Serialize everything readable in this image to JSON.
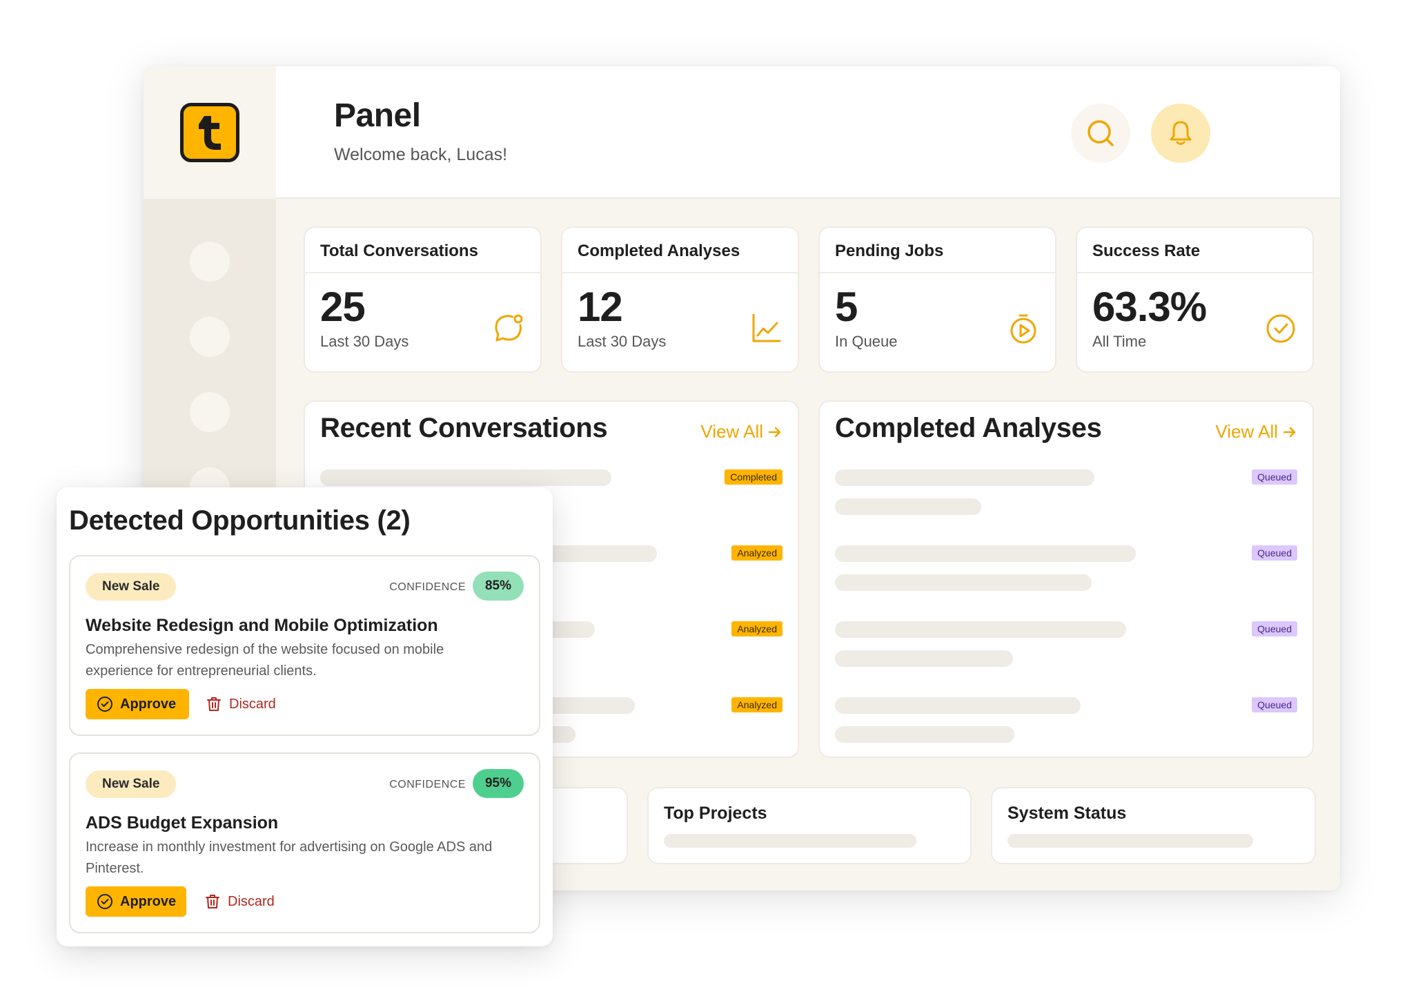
{
  "header": {
    "title": "Panel",
    "subtitle": "Welcome back, Lucas!"
  },
  "colors": {
    "accent": "#ffb400",
    "purple_badge": "#dcc7ff",
    "confidence_85": "#93e0b8",
    "confidence_95": "#4fcf8f",
    "discard_red": "#b3261e"
  },
  "stats": [
    {
      "title": "Total Conversations",
      "value": "25",
      "sub": "Last 30 Days",
      "icon": "chat-icon"
    },
    {
      "title": "Completed Analyses",
      "value": "12",
      "sub": "Last 30 Days",
      "icon": "chart-line-icon"
    },
    {
      "title": "Pending Jobs",
      "value": "5",
      "sub": "In Queue",
      "icon": "timer-play-icon"
    },
    {
      "title": "Success Rate",
      "value": "63.3%",
      "sub": "All Time",
      "icon": "check-circle-icon"
    }
  ],
  "recent_conversations": {
    "title": "Recent Conversations",
    "view_all": "View All",
    "badges": [
      "Completed",
      "Analyzed",
      "Analyzed",
      "Analyzed"
    ]
  },
  "completed_analyses": {
    "title": "Completed Analyses",
    "view_all": "View All",
    "badges": [
      "Queued",
      "Queued",
      "Queued",
      "Queued"
    ]
  },
  "bottom_cards": {
    "top_projects": "Top Projects",
    "system_status": "System Status"
  },
  "opportunities": {
    "title": "Detected Opportunities (2)",
    "items": [
      {
        "tag": "New Sale",
        "confidence_label": "CONFIDENCE",
        "confidence": "85%",
        "title": "Website Redesign and Mobile Optimization",
        "description": "Comprehensive redesign of the website focused on mobile experience for entrepreneurial clients.",
        "approve": "Approve",
        "discard": "Discard"
      },
      {
        "tag": "New Sale",
        "confidence_label": "CONFIDENCE",
        "confidence": "95%",
        "title": "ADS Budget Expansion",
        "description": "Increase in monthly investment for advertising on Google ADS and Pinterest.",
        "approve": "Approve",
        "discard": "Discard"
      }
    ]
  }
}
